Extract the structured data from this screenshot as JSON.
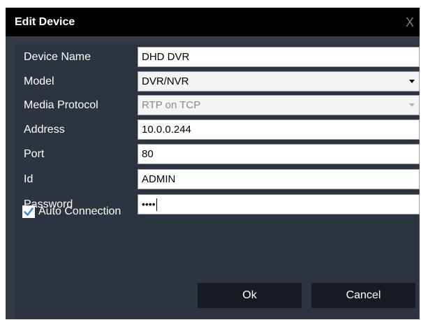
{
  "dialog": {
    "title": "Edit Device",
    "close_glyph": "X"
  },
  "fields": [
    {
      "label": "Device Name",
      "value": "DHD DVR"
    },
    {
      "label": "Model",
      "value": "DVR/NVR"
    },
    {
      "label": "Media Protocol",
      "value": "RTP on TCP"
    },
    {
      "label": "Address",
      "value": "10.0.0.244"
    },
    {
      "label": "Port",
      "value": "80"
    },
    {
      "label": "Id",
      "value": "ADMIN"
    },
    {
      "label": "Password",
      "value": "••••"
    }
  ],
  "auto_connection": {
    "label": "Auto Connection",
    "checked": true
  },
  "buttons": {
    "ok": "Ok",
    "cancel": "Cancel"
  },
  "colors": {
    "dialog_bg": "#333b46",
    "titlebar_bg": "#000000",
    "button_bg": "#161b22",
    "check_color": "#3a8fd8"
  },
  "icons": {
    "close": "close-icon",
    "dropdown": "chevron-down-icon",
    "check": "check-icon"
  }
}
